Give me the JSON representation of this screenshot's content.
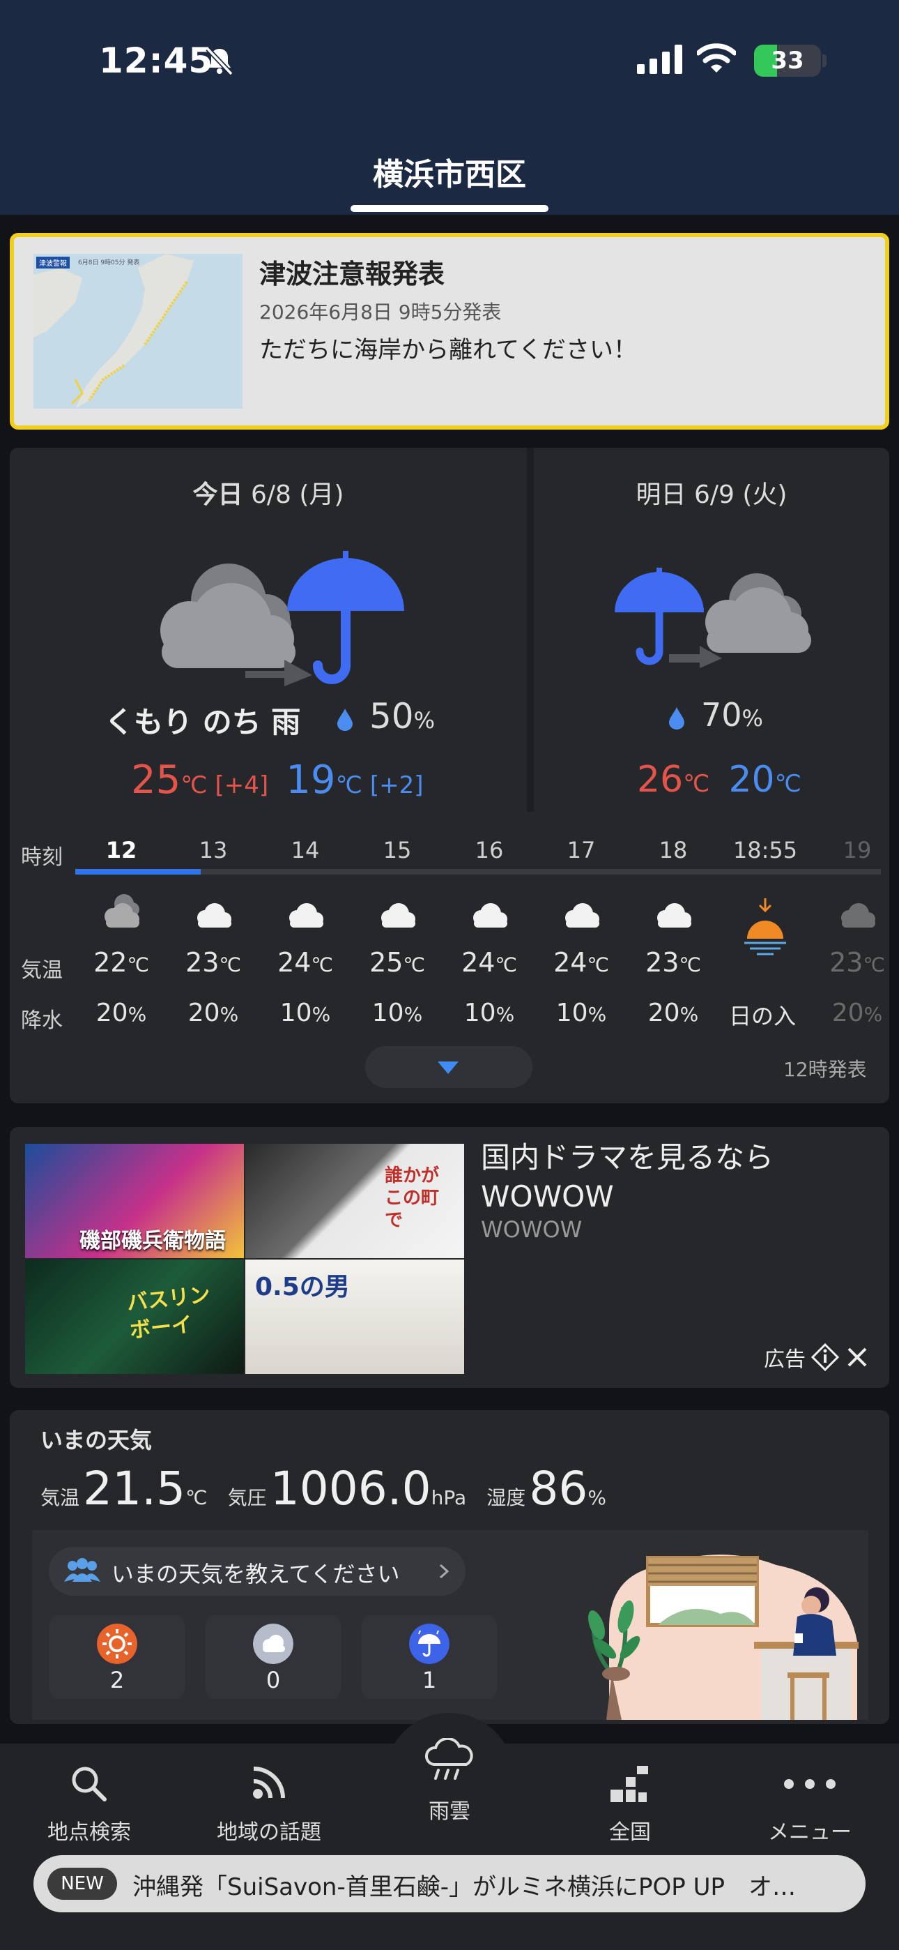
{
  "status_bar": {
    "time": "12:45",
    "battery": "33",
    "icons": [
      "bell-slash-icon",
      "signal-icon",
      "wifi-icon",
      "battery-icon"
    ]
  },
  "header": {
    "location": "横浜市西区"
  },
  "alert": {
    "title": "津波注意報発表",
    "date": "2026年6月8日 9時5分発表",
    "message": "ただちに海岸から離れてください！",
    "map_label": "津波警報",
    "map_date": "6月8日 9時05分 発表"
  },
  "forecast": {
    "today": {
      "day": "今日",
      "date": "6/8 (月)",
      "condition": "くもり のち 雨",
      "precip": "50",
      "precip_unit": "%",
      "high": "25",
      "high_diff": "[+4]",
      "low": "19",
      "low_diff": "[+2]",
      "temp_unit": "℃",
      "icons": [
        "cloud-icon",
        "umbrella-icon"
      ]
    },
    "tomorrow": {
      "day": "明日",
      "date": "6/9 (火)",
      "precip": "70",
      "precip_unit": "%",
      "high": "26",
      "low": "20",
      "temp_unit": "℃",
      "icons": [
        "umbrella-icon",
        "cloud-icon"
      ]
    },
    "hourly": {
      "labels": {
        "time": "時刻",
        "temp": "気温",
        "rain": "降水"
      },
      "hours": [
        {
          "time": "12",
          "temp": "22",
          "rain": "20"
        },
        {
          "time": "13",
          "temp": "23",
          "rain": "20"
        },
        {
          "time": "14",
          "temp": "24",
          "rain": "10"
        },
        {
          "time": "15",
          "temp": "25",
          "rain": "10"
        },
        {
          "time": "16",
          "temp": "24",
          "rain": "10"
        },
        {
          "time": "17",
          "temp": "24",
          "rain": "10"
        },
        {
          "time": "18",
          "temp": "23",
          "rain": "20"
        },
        {
          "time": "18:55",
          "temp": "",
          "rain": "日の入",
          "sunset": true
        },
        {
          "time": "19",
          "temp": "23",
          "rain": "20"
        }
      ],
      "temp_unit": "℃",
      "rain_unit": "%",
      "issued": "12時発表"
    }
  },
  "ad": {
    "title": "国内ドラマを見るなら WOWOW",
    "advertiser": "WOWOW",
    "label": "広告",
    "posters": [
      "磯部磯兵衛物語",
      "誰かがこの町で",
      "バスリンボーイ",
      "0.5の男"
    ]
  },
  "now": {
    "title": "いまの天気",
    "temp_label": "気温",
    "temp": "21.5",
    "temp_unit": "℃",
    "pressure_label": "気圧",
    "pressure": "1006.0",
    "pressure_unit": "hPa",
    "humidity_label": "湿度",
    "humidity": "86",
    "humidity_unit": "%",
    "cta": "いまの天気を教えてください",
    "votes": [
      {
        "icon": "sun-icon",
        "count": "2",
        "color": "#e8632b"
      },
      {
        "icon": "cloud-icon",
        "count": "0",
        "color": "#b7bccb"
      },
      {
        "icon": "umbrella-icon",
        "count": "1",
        "color": "#3d63e8"
      }
    ]
  },
  "nav": {
    "items": [
      {
        "label": "地点検索",
        "icon": "search-icon"
      },
      {
        "label": "地域の話題",
        "icon": "feed-icon"
      },
      {
        "label": "雨雲",
        "icon": "rain-cloud-icon"
      },
      {
        "label": "全国",
        "icon": "chart-icon"
      },
      {
        "label": "メニュー",
        "icon": "more-icon"
      }
    ]
  },
  "ticker": {
    "badge": "NEW",
    "text": "沖縄発「SuiSavon-首里石鹸-」がルミネ横浜にPOP UP　オ…"
  },
  "colors": {
    "header_bg": "#1b2943",
    "alert_border": "#f2cf1d",
    "high_temp": "#e5544b",
    "low_temp": "#4a8cf0",
    "accent": "#2f74ea"
  }
}
